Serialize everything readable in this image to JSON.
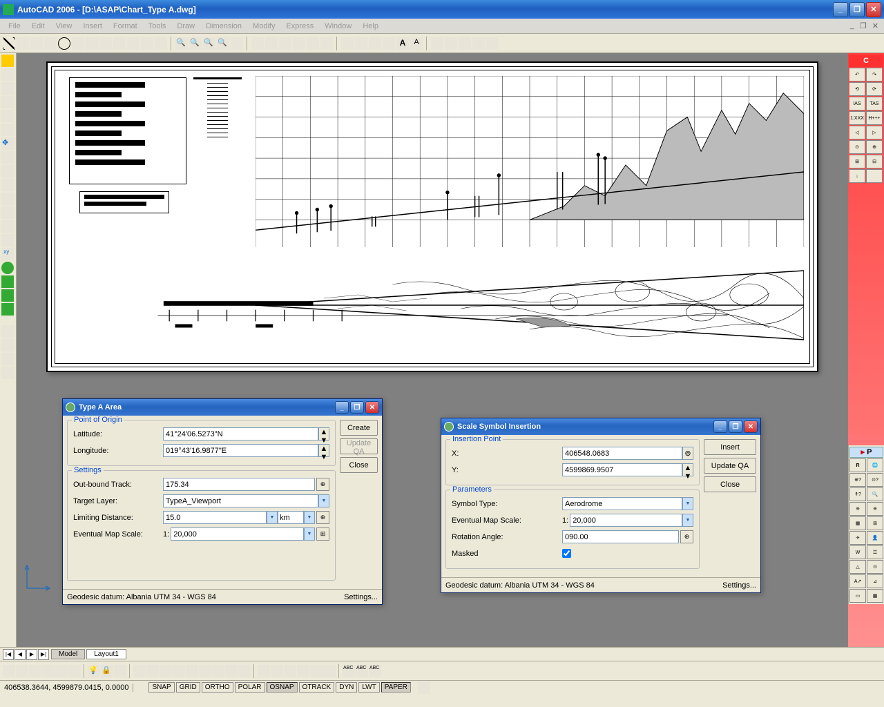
{
  "app": {
    "title": "AutoCAD 2006 - [D:\\ASAP\\Chart_Type A.dwg]"
  },
  "menu": {
    "items": [
      "File",
      "Edit",
      "View",
      "Insert",
      "Format",
      "Tools",
      "Draw",
      "Dimension",
      "Modify",
      "Express",
      "Window",
      "Help"
    ]
  },
  "layout_tabs": {
    "model": "Model",
    "layout1": "Layout1"
  },
  "status": {
    "coords": "406538.3644, 4599879.0415, 0.0000",
    "toggles": [
      "SNAP",
      "GRID",
      "ORTHO",
      "POLAR",
      "OSNAP",
      "OTRACK",
      "DYN",
      "LWT",
      "PAPER"
    ]
  },
  "dialog_a": {
    "title": "Type A Area",
    "buttons": {
      "create": "Create",
      "update": "Update QA",
      "close": "Close"
    },
    "origin": {
      "legend": "Point of Origin",
      "lat_label": "Latitude:",
      "lat_value": "41°24'06.5273\"N",
      "lon_label": "Longitude:",
      "lon_value": "019°43'16.9877\"E"
    },
    "settings": {
      "legend": "Settings",
      "track_label": "Out-bound Track:",
      "track_value": "175.34",
      "layer_label": "Target Layer:",
      "layer_value": "TypeA_Viewport",
      "limit_label": "Limiting Distance:",
      "limit_value": "15.0",
      "limit_unit": "km",
      "scale_label": "Eventual Map Scale:",
      "scale_prefix": "1:",
      "scale_value": "20,000"
    },
    "footer": {
      "datum": "Geodesic datum: Albania UTM 34 - WGS 84",
      "settings": "Settings..."
    }
  },
  "dialog_b": {
    "title": "Scale Symbol Insertion",
    "buttons": {
      "insert": "Insert",
      "update": "Update QA",
      "close": "Close"
    },
    "point": {
      "legend": "Insertion Point",
      "x_label": "X:",
      "x_value": "406548.0683",
      "y_label": "Y:",
      "y_value": "4599869.9507"
    },
    "params": {
      "legend": "Parameters",
      "type_label": "Symbol Type:",
      "type_value": "Aerodrome",
      "scale_label": "Eventual Map Scale:",
      "scale_prefix": "1:",
      "scale_value": "20,000",
      "rot_label": "Rotation Angle:",
      "rot_value": "090.00",
      "mask_label": "Masked"
    },
    "footer": {
      "datum": "Geodesic datum: Albania UTM 34 - WGS 84",
      "settings": "Settings..."
    }
  },
  "right_panel_top": {
    "header": "C",
    "labels": [
      "IAS",
      "TAS",
      "1:XXX",
      "H+++"
    ]
  },
  "right_panel_bottom": {
    "header": "P"
  }
}
